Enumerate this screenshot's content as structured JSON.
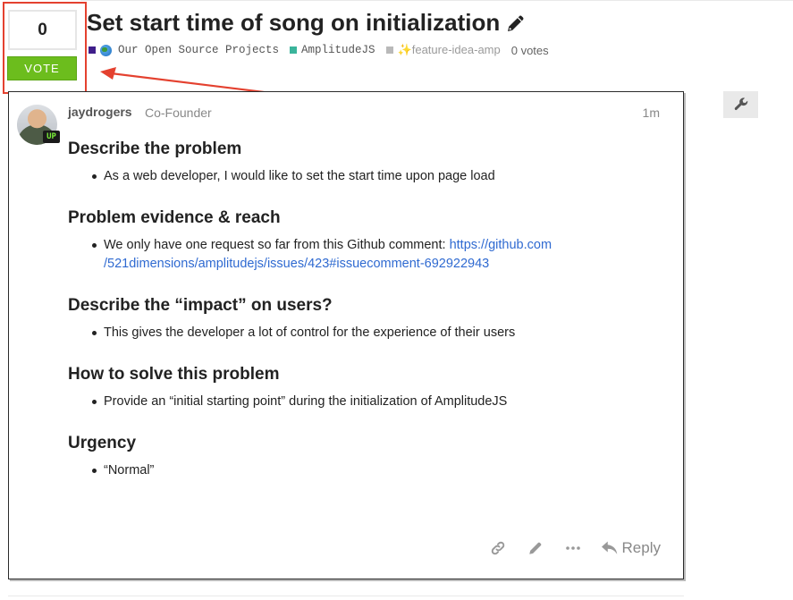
{
  "vote": {
    "count": "0",
    "button_label": "VOTE"
  },
  "topic": {
    "title": "Set start time of song on initialization",
    "categories": [
      {
        "label": "Our Open Source Projects",
        "color": "#3f1e8a"
      },
      {
        "label": "AmplitudeJS",
        "color": "#3ab49b"
      }
    ],
    "tag": {
      "label": "✨feature-idea-amp",
      "color": "#b9b9b9"
    },
    "votes_text": "0 votes"
  },
  "post": {
    "username": "jaydrogers",
    "user_title": "Co-Founder",
    "date": "1m",
    "avatar_flair": "UP",
    "sections": [
      {
        "heading": "Describe the problem",
        "bullet": "As a web developer, I would like to set the start time upon page load"
      },
      {
        "heading": "Problem evidence & reach",
        "bullet": "We only have one request so far from this Github comment: ",
        "link_line1": "https://github.com",
        "link_line2": "/521dimensions/amplitudejs/issues/423#issuecomment-692922943"
      },
      {
        "heading": "Describe the “impact” on users?",
        "bullet": "This gives the developer a lot of control for the experience of their users"
      },
      {
        "heading": "How to solve this problem",
        "bullet": "Provide an “initial starting point” during the initialization of AmplitudeJS"
      },
      {
        "heading": "Urgency",
        "bullet": "“Normal”"
      }
    ],
    "reply_label": "Reply"
  },
  "colors": {
    "vote_green": "#6cbd1d",
    "highlight_red": "#e4412f",
    "link_blue": "#2f6ad1"
  },
  "icons": [
    "pencil-icon",
    "globe-icon",
    "wrench-icon",
    "link-icon",
    "edit-icon",
    "more-icon",
    "reply-icon"
  ]
}
